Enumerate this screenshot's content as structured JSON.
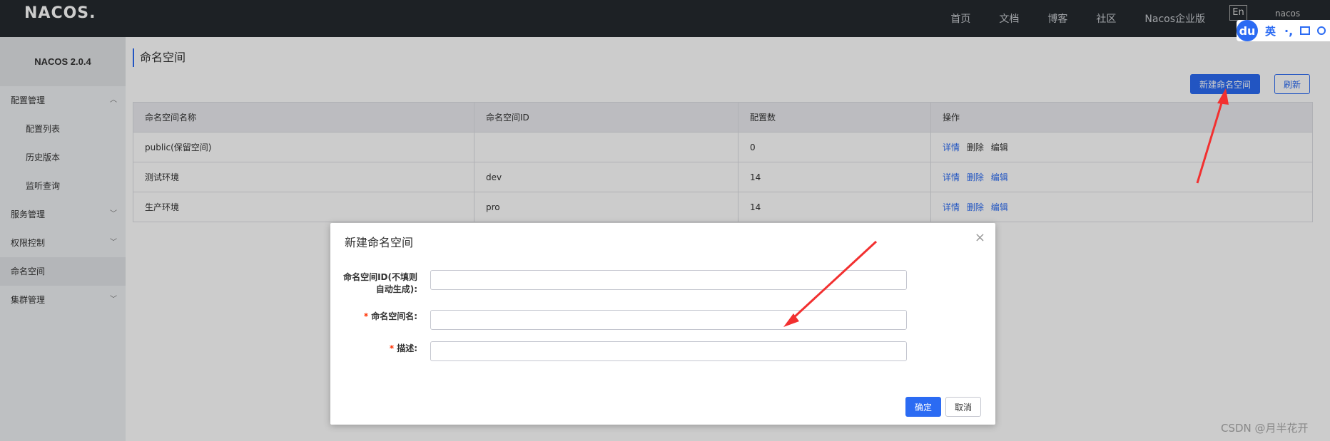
{
  "topbar": {
    "logo": "NACOS.",
    "nav": [
      "首页",
      "文档",
      "博客",
      "社区",
      "Nacos企业版"
    ],
    "lang": "En",
    "user": "nacos"
  },
  "ime": {
    "logo": "du",
    "text": "英",
    "dot": "·,"
  },
  "sidebar": {
    "version": "NACOS 2.0.4",
    "items": [
      {
        "label": "配置管理",
        "chevron": "︿"
      },
      {
        "label": "配置列表"
      },
      {
        "label": "历史版本"
      },
      {
        "label": "监听查询"
      },
      {
        "label": "服务管理",
        "chevron": "﹀"
      },
      {
        "label": "权限控制",
        "chevron": "﹀"
      },
      {
        "label": "命名空间"
      },
      {
        "label": "集群管理",
        "chevron": "﹀"
      }
    ]
  },
  "main": {
    "title": "命名空间",
    "new_button": "新建命名空间",
    "refresh_button": "刷新",
    "table": {
      "headers": [
        "命名空间名称",
        "命名空间ID",
        "配置数",
        "操作"
      ],
      "rows": [
        {
          "name": "public(保留空间)",
          "id": "",
          "count": "0"
        },
        {
          "name": "测试环境",
          "id": "dev",
          "count": "14"
        },
        {
          "name": "生产环境",
          "id": "pro",
          "count": "14"
        }
      ],
      "actions": {
        "details": "详情",
        "delete": "删除",
        "edit": "编辑"
      }
    }
  },
  "dialog": {
    "title": "新建命名空间",
    "close": "×",
    "fields": {
      "id_label_line1": "命名空间ID(不填则",
      "id_label_line2": "自动生成):",
      "name_label": "命名空间名:",
      "desc_label": "描述:",
      "required_mark": "*"
    },
    "ok_button": "确定",
    "cancel_button": "取消"
  },
  "watermark": "CSDN @月半花开",
  "colors": {
    "primary": "#2b6bf3",
    "arrow": "#f23030"
  }
}
